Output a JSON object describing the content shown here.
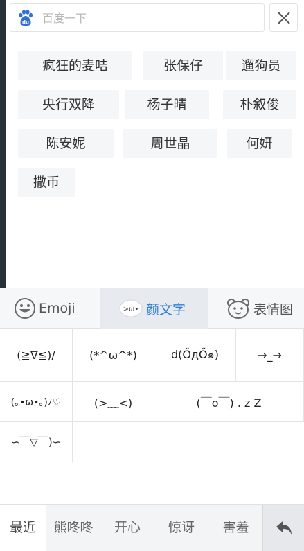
{
  "search": {
    "placeholder": "百度一下"
  },
  "suggestions": [
    "疯狂的麦咭",
    "张保仔",
    "遛狗员",
    "央行双降",
    "杨子晴",
    "朴叙俊",
    "陈安妮",
    "周世晶",
    "何妍",
    "撒币"
  ],
  "tabs": [
    {
      "label": "Emoji",
      "icon": "emoji-smiley-icon"
    },
    {
      "label": "颜文字",
      "icon": "kaomoji-bubble-icon",
      "active": true
    },
    {
      "label": "表情图",
      "icon": "bear-face-icon"
    }
  ],
  "kaomoji": [
    "(≧∇≦)/",
    "(*^ω^*)",
    "d(ŐдŐ๑)",
    "→_→",
    "(｡•ω•｡)ﾉ♡",
    "(>﹏<)",
    "(￣o￣) . z Z",
    "∽￣▽￣)∽"
  ],
  "categories": [
    "最近",
    "熊咚咚",
    "开心",
    "惊讶",
    "害羞"
  ],
  "colors": {
    "accent": "#2c7fe0",
    "baidu_blue": "#2f6fd6"
  }
}
